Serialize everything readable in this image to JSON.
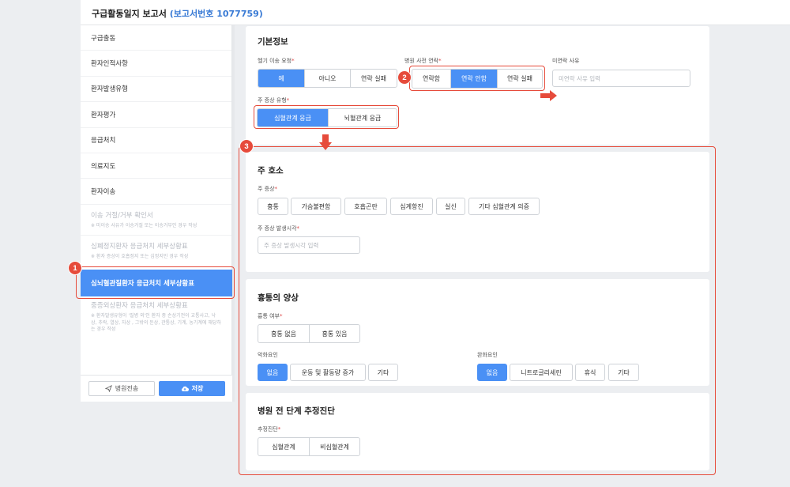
{
  "header": {
    "title": "구급활동일지 보고서",
    "report_no": "(보고서번호 1077759)"
  },
  "sidebar": {
    "items": [
      {
        "label": "구급출동"
      },
      {
        "label": "환자인적사항"
      },
      {
        "label": "환자발생유형"
      },
      {
        "label": "환자평가"
      },
      {
        "label": "응급처치"
      },
      {
        "label": "의료지도"
      },
      {
        "label": "환자이송"
      }
    ],
    "dim_items": [
      {
        "title": "이송 거절/거부 확인서",
        "sub": "※ 미이송 사유가 이송거절 또는 이송거부인 경우 작성"
      },
      {
        "title": "심폐정지환자 응급처치 세부상황표",
        "sub": "※ 환자 증상이 호흡정지 또는 심정지인 경우 작성"
      }
    ],
    "active_item": "심뇌혈관질환자 응급처치 세부상황표",
    "dim_last": {
      "title": "중증외상환자 응급처치 세부상황표",
      "sub": "※ 환자발생유형이 '질병 외'인 환자 중 손상기전이 교통사고, 낙상, 추락, 열상, 자상 , 그밖의 둔상, 관통상, 기계, 농기계에 해당하는 경우 작성"
    },
    "footer": {
      "transfer_label": "병원전송",
      "save_label": "저장"
    }
  },
  "basic_info": {
    "heading": "기본정보",
    "heli": {
      "label": "헬기 이송 요청",
      "options": [
        "예",
        "아니오",
        "연락 실패"
      ],
      "selected": 0
    },
    "hospital_contact": {
      "label": "병원 사전 연락",
      "options": [
        "연락함",
        "연락 안함",
        "연락 실패"
      ],
      "selected": 1
    },
    "no_contact_reason": {
      "label": "미연락 사유",
      "placeholder": "미연락 사유 입력"
    },
    "main_symptom_type": {
      "label": "주 증상 유형",
      "options": [
        "심혈관계 응급",
        "뇌혈관계 응급"
      ],
      "selected": 0
    }
  },
  "chief_complaint": {
    "heading": "주 호소",
    "symptom_label": "주 증상",
    "symptoms": [
      "흉통",
      "가슴불편함",
      "호흡곤란",
      "심계항진",
      "실신",
      "기타 심혈관계 의증"
    ],
    "onset_label": "주 증상 발생시각",
    "onset_placeholder": "주 증상 발생시각 입력"
  },
  "chest_pain": {
    "heading": "흉통의 양상",
    "presence_label": "흉통 여부",
    "presence_options": [
      "흉통 없음",
      "흉통 있음"
    ],
    "aggravating_label": "악화요인",
    "aggravating_options": [
      "없음",
      "운동 및 활동량 증가",
      "기타"
    ],
    "aggravating_selected": 0,
    "relieving_label": "완화요인",
    "relieving_options": [
      "없음",
      "니트로글리세린",
      "휴식",
      "기타"
    ],
    "relieving_selected": 0
  },
  "prehospital_dx": {
    "heading": "병원 전 단계 추정진단",
    "label": "추정진단",
    "options": [
      "심혈관계",
      "비심혈관계"
    ]
  },
  "annotations": {
    "badge1": "1",
    "badge2": "2",
    "badge3": "3"
  },
  "colors": {
    "accent": "#4a90f5",
    "annotation": "#e64b3b",
    "required": "#e04848"
  },
  "icons": {
    "transfer": "send-icon",
    "save": "cloud-upload-icon",
    "arrow": "arrow-icon"
  }
}
